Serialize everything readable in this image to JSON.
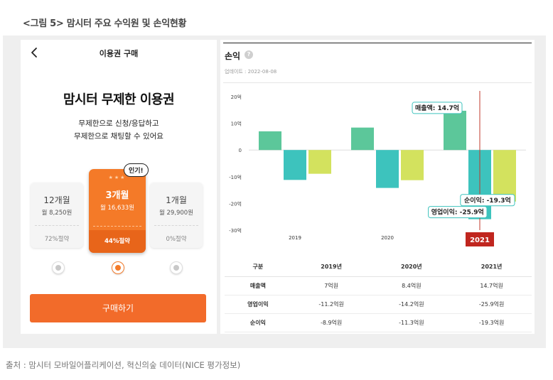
{
  "figure_title": "<그림 5> 맘시터 주요 수익원 및 손익현황",
  "source": "출처 : 맘시터 모바일어플리케이션, 혁신의숲 데이터(NICE 평가정보)",
  "app": {
    "title": "이용권 구매",
    "hero": "맘시터 무제한 이용권",
    "subtitle_line1": "무제한으로 신청/응답하고",
    "subtitle_line2": "무제한으로 채팅할 수 있어요",
    "badge": "인기!",
    "plans": [
      {
        "name": "12개월",
        "price": "월 8,250원",
        "discount": "72%절약"
      },
      {
        "name": "3개월",
        "price": "월 16,633원",
        "discount": "44%절약",
        "stars": "★★★"
      },
      {
        "name": "1개월",
        "price": "월 29,900원",
        "discount": "0%절약"
      }
    ],
    "selected_plan_index": 1,
    "buy_label": "구매하기",
    "accent": "#f26b2a"
  },
  "dashboard": {
    "title": "손익",
    "help_glyph": "?",
    "updated": "업데이트 : 2022-08-08",
    "table": {
      "headers": [
        "구분",
        "2019년",
        "2020년",
        "2021년"
      ],
      "rows": [
        [
          "매출액",
          "7억원",
          "8.4억원",
          "14.7억원"
        ],
        [
          "영업이익",
          "-11.2억원",
          "-14.2억원",
          "-25.9억원"
        ],
        [
          "순이익",
          "-8.9억원",
          "-11.3억원",
          "-19.3억원"
        ]
      ]
    }
  },
  "chart_data": {
    "type": "bar",
    "categories": [
      "2019",
      "2020",
      "2021"
    ],
    "highlight_category": "2021",
    "series": [
      {
        "name": "매출액",
        "color": "#5cc79a",
        "values": [
          7,
          8.4,
          14.7
        ]
      },
      {
        "name": "영업이익",
        "color": "#3dc3bd",
        "values": [
          -11.2,
          -14.2,
          -25.9
        ]
      },
      {
        "name": "순이익",
        "color": "#d3e25e",
        "values": [
          -8.9,
          -11.3,
          -19.3
        ]
      }
    ],
    "yticks": [
      20,
      10,
      0,
      -10,
      -20,
      -30
    ],
    "ytick_labels": [
      "20억",
      "10억",
      "0",
      "-10억",
      "-20억",
      "-30억"
    ],
    "ylim": [
      -30,
      20
    ],
    "callouts": [
      {
        "series_index": 0,
        "category_index": 2,
        "text": "매출액: 14.7억"
      },
      {
        "series_index": 2,
        "category_index": 2,
        "text": "순이익: -19.3억"
      },
      {
        "series_index": 1,
        "category_index": 2,
        "text": "영업이익: -25.9억"
      }
    ],
    "grid": false,
    "legend": "none"
  }
}
